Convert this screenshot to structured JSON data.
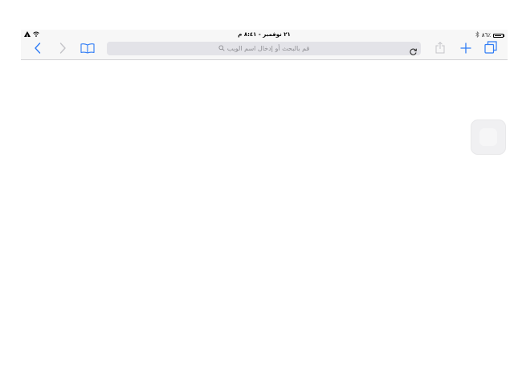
{
  "status_bar": {
    "datetime": "٢١ نوفمبر - ٨:٤١ م",
    "battery_percent": "٨٦٪",
    "battery_level": 0.86,
    "icons": [
      "airplane-icon",
      "wifi-icon",
      "bluetooth-icon",
      "battery-icon"
    ]
  },
  "toolbar": {
    "back_icon": "chevron-left-icon",
    "forward_icon": "chevron-right-icon",
    "bookmarks_icon": "book-icon",
    "share_icon": "share-icon",
    "new_tab_icon": "plus-icon",
    "tabs_icon": "tabs-icon",
    "accent_color": "#2f7cf6",
    "disabled_color": "#c4c4c8"
  },
  "address_bar": {
    "placeholder": "قم بالبحث أو إدخال اسم الويب",
    "search_icon": "search-icon",
    "reload_icon": "reload-icon"
  },
  "assistive_touch": {
    "icon": "assistive-touch-icon"
  }
}
